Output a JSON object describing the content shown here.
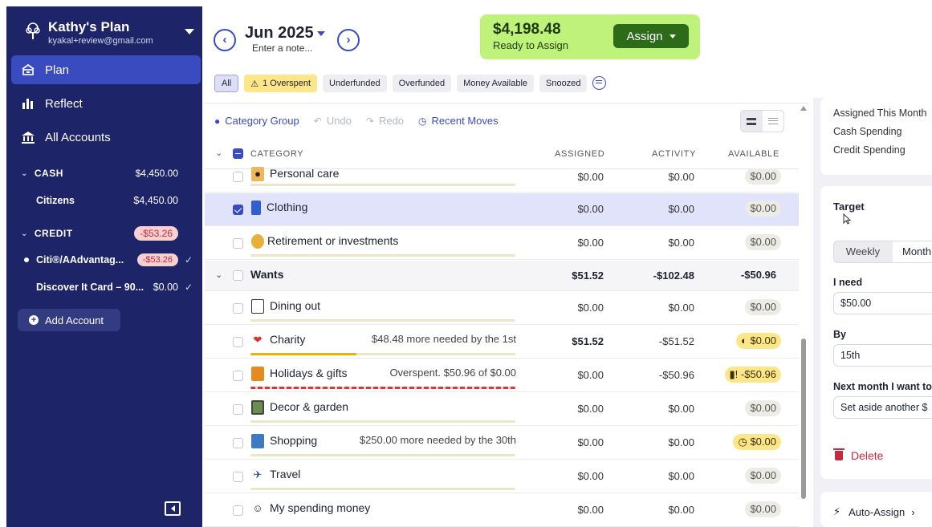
{
  "sidebar": {
    "plan_name": "Kathy's Plan",
    "email": "kyakal+review@gmail.com",
    "nav": [
      {
        "label": "Plan",
        "icon": "plan-icon"
      },
      {
        "label": "Reflect",
        "icon": "chart-icon"
      },
      {
        "label": "All Accounts",
        "icon": "bank-icon"
      }
    ],
    "groups": {
      "cash": {
        "label": "CASH",
        "amount": "$4,450.00"
      },
      "credit": {
        "label": "CREDIT",
        "amount": "-$53.26"
      }
    },
    "accounts": {
      "citizens": {
        "name": "Citizens",
        "amount": "$4,450.00"
      },
      "citi": {
        "name": "Citi®/AAdvantag...",
        "amount": "-$53.26"
      },
      "discover": {
        "name": "Discover It Card – 90...",
        "amount": "$0.00"
      }
    },
    "add_account": "Add Account"
  },
  "header": {
    "month": "Jun 2025",
    "note_placeholder": "Enter a note...",
    "ready_amount": "$4,198.48",
    "ready_label": "Ready to Assign",
    "assign_label": "Assign"
  },
  "filters": [
    "All",
    "1 Overspent",
    "Underfunded",
    "Overfunded",
    "Money Available",
    "Snoozed"
  ],
  "toolbar": {
    "category_group": "Category Group",
    "undo": "Undo",
    "redo": "Redo",
    "recent_moves": "Recent Moves"
  },
  "columns": {
    "category": "CATEGORY",
    "assigned": "ASSIGNED",
    "activity": "ACTIVITY",
    "available": "AVAILABLE"
  },
  "rows": [
    {
      "name": "Personal care",
      "assigned": "$0.00",
      "activity": "$0.00",
      "available": "$0.00",
      "message": ""
    },
    {
      "name": "Clothing",
      "assigned": "$0.00",
      "activity": "$0.00",
      "available": "$0.00",
      "message": ""
    },
    {
      "name": "Retirement or investments",
      "assigned": "$0.00",
      "activity": "$0.00",
      "available": "$0.00",
      "message": ""
    },
    {
      "name": "Wants",
      "assigned": "$51.52",
      "activity": "-$102.48",
      "available": "-$50.96",
      "message": ""
    },
    {
      "name": "Dining out",
      "assigned": "$0.00",
      "activity": "$0.00",
      "available": "$0.00",
      "message": ""
    },
    {
      "name": "Charity",
      "assigned": "$51.52",
      "activity": "-$51.52",
      "available": "$0.00",
      "message": "$48.48 more needed by the 1st"
    },
    {
      "name": "Holidays & gifts",
      "assigned": "$0.00",
      "activity": "-$50.96",
      "available": "-$50.96",
      "message": "Overspent. $50.96 of $0.00"
    },
    {
      "name": "Decor & garden",
      "assigned": "$0.00",
      "activity": "$0.00",
      "available": "$0.00",
      "message": ""
    },
    {
      "name": "Shopping",
      "assigned": "$0.00",
      "activity": "$0.00",
      "available": "$0.00",
      "message": "$250.00 more needed by the 30th"
    },
    {
      "name": "Travel",
      "assigned": "$0.00",
      "activity": "$0.00",
      "available": "$0.00",
      "message": ""
    },
    {
      "name": "My spending money",
      "assigned": "$0.00",
      "activity": "$0.00",
      "available": "$0.00",
      "message": ""
    }
  ],
  "inspector": {
    "summary": [
      "Assigned This Month",
      "Cash Spending",
      "Credit Spending"
    ],
    "target_title": "Target",
    "tabs": [
      "Weekly",
      "Monthly"
    ],
    "i_need_label": "I need",
    "i_need_value": "$50.00",
    "by_label": "By",
    "by_value": "15th",
    "next_month_label": "Next month I want to",
    "next_month_value": "Set aside another $",
    "delete_label": "Delete",
    "auto_assign": "Auto-Assign"
  },
  "colors": {
    "sidebar": "#1d2468",
    "accent": "#3a4bc0",
    "ready_bg": "#bff27a",
    "assign_btn": "#2c6b18",
    "danger": "#c6293c"
  }
}
